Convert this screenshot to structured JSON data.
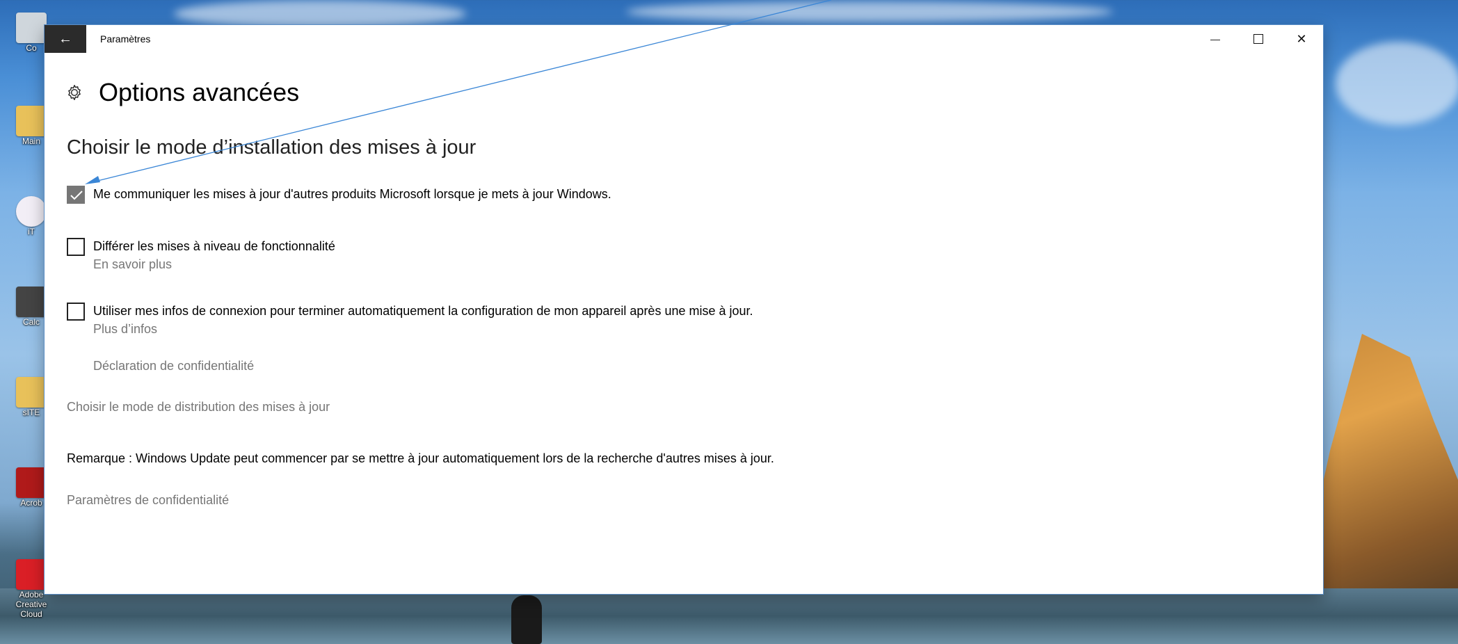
{
  "desktop": {
    "icons": [
      {
        "label": "Co",
        "name": "recycle-bin"
      },
      {
        "label": "Main",
        "name": "folder"
      },
      {
        "label": "iT",
        "name": "itunes"
      },
      {
        "label": "Calc",
        "name": "calculator"
      },
      {
        "label": "sITE",
        "name": "folder-site"
      },
      {
        "label": "Acrob",
        "name": "acrobat"
      },
      {
        "label": "Adobe Creative Cloud",
        "name": "creative-cloud"
      }
    ]
  },
  "window": {
    "title": "Paramètres",
    "back_glyph": "←",
    "minimize_glyph": "—",
    "close_glyph": "✕"
  },
  "page": {
    "title": "Options avancées",
    "section_title": "Choisir le mode d’installation des mises à jour",
    "options": [
      {
        "label": "Me communiquer les mises à jour d'autres produits Microsoft lorsque je mets à jour Windows.",
        "checked": true,
        "sub": ""
      },
      {
        "label": "Différer les mises à niveau de fonctionnalité",
        "checked": false,
        "sub": "En savoir plus"
      },
      {
        "label": "Utiliser mes infos de connexion pour terminer automatiquement la configuration de mon appareil après une mise à jour.",
        "checked": false,
        "sub": "Plus d’infos"
      }
    ],
    "privacy_statement": "Déclaration de confidentialité",
    "delivery_link": "Choisir le mode de distribution des mises à jour",
    "note": "Remarque : Windows Update peut commencer par se mettre à jour automatiquement lors de la recherche d'autres mises à jour.",
    "privacy_settings": "Paramètres de confidentialité"
  },
  "colors": {
    "accent_arrow": "#3a86d6",
    "checked_box": "#767676",
    "link_grey": "#767676"
  }
}
